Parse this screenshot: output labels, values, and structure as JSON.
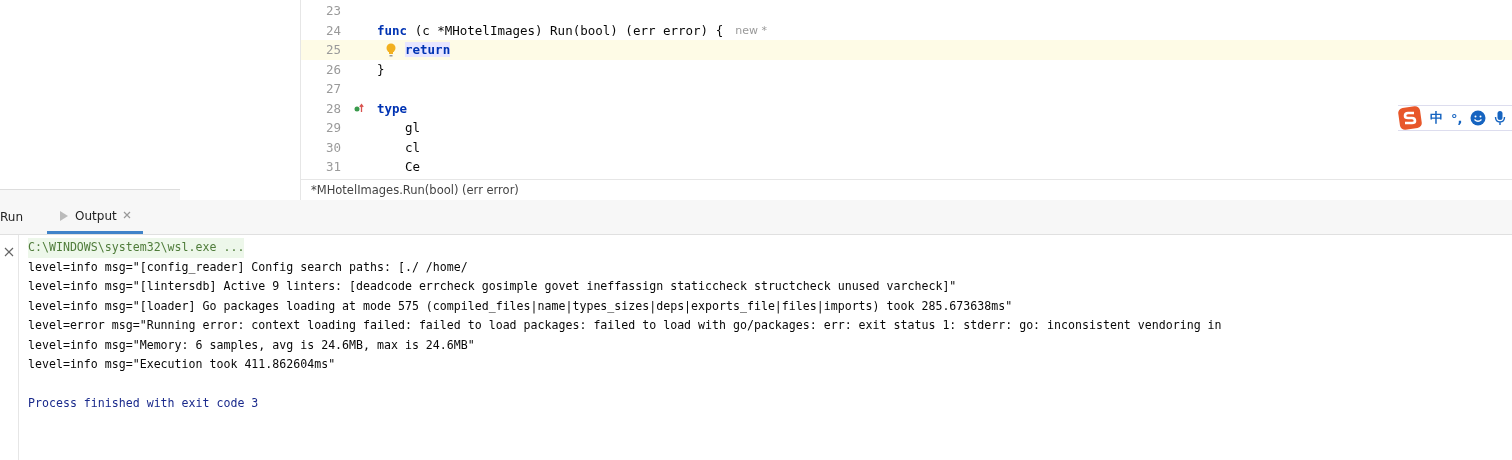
{
  "editor": {
    "lines": [
      {
        "number": "23"
      },
      {
        "number": "24",
        "tokens": [
          {
            "kind": "keyword",
            "text": "func"
          },
          {
            "kind": "plain",
            "text": " (c *MHotelImages) Run(bool) (err error) {"
          }
        ],
        "hint": "new *",
        "children": [
          {
            "number": "25",
            "current": true,
            "bulb": true,
            "tokens": [
              {
                "kind": "keyword",
                "text": "return"
              }
            ]
          }
        ]
      },
      {
        "number": "26",
        "tokens": [
          {
            "kind": "plain",
            "text": "}"
          }
        ]
      },
      {
        "number": "27"
      },
      {
        "number": "28",
        "marker": true,
        "tokens": [
          {
            "kind": "keyword",
            "text": "type"
          }
        ],
        "children": [
          {
            "number": "29",
            "tokens": [
              {
                "kind": "plain",
                "text": "gl"
              }
            ]
          },
          {
            "number": "30",
            "tokens": [
              {
                "kind": "plain",
                "text": "cl"
              }
            ]
          },
          {
            "number": "31",
            "tokens": [
              {
                "kind": "plain",
                "text": "Ce"
              }
            ]
          }
        ]
      }
    ],
    "breadcrumb": "*MHotelImages.Run(bool) (err error)"
  },
  "ime_bar": {
    "mode": "中",
    "punctuation": "°,"
  },
  "tool_window": {
    "title": "Run",
    "tabs": [
      {
        "label": "Output",
        "selected": true
      }
    ]
  },
  "console": {
    "lines": [
      {
        "kind": "command",
        "text": "C:\\WINDOWS\\system32\\wsl.exe ..."
      },
      {
        "kind": "log",
        "text": "level=info msg=\"[config_reader] Config search paths: [./ /home/"
      },
      {
        "kind": "log",
        "text": "level=info msg=\"[lintersdb] Active 9 linters: [deadcode errcheck gosimple govet ineffassign staticcheck structcheck unused varcheck]\""
      },
      {
        "kind": "log",
        "text": "level=info msg=\"[loader] Go packages loading at mode 575 (compiled_files|name|types_sizes|deps|exports_file|files|imports) took 285.673638ms\""
      },
      {
        "kind": "log",
        "text": "level=error msg=\"Running error: context loading failed: failed to load packages: failed to load with go/packages: err: exit status 1: stderr: go: inconsistent vendoring in"
      },
      {
        "kind": "log",
        "text": "level=info msg=\"Memory: 6 samples, avg is 24.6MB, max is 24.6MB\""
      },
      {
        "kind": "log",
        "text": "level=info msg=\"Execution took 411.862604ms\""
      },
      {
        "kind": "blank"
      },
      {
        "kind": "exit",
        "text": "Process finished with exit code 3"
      }
    ]
  }
}
